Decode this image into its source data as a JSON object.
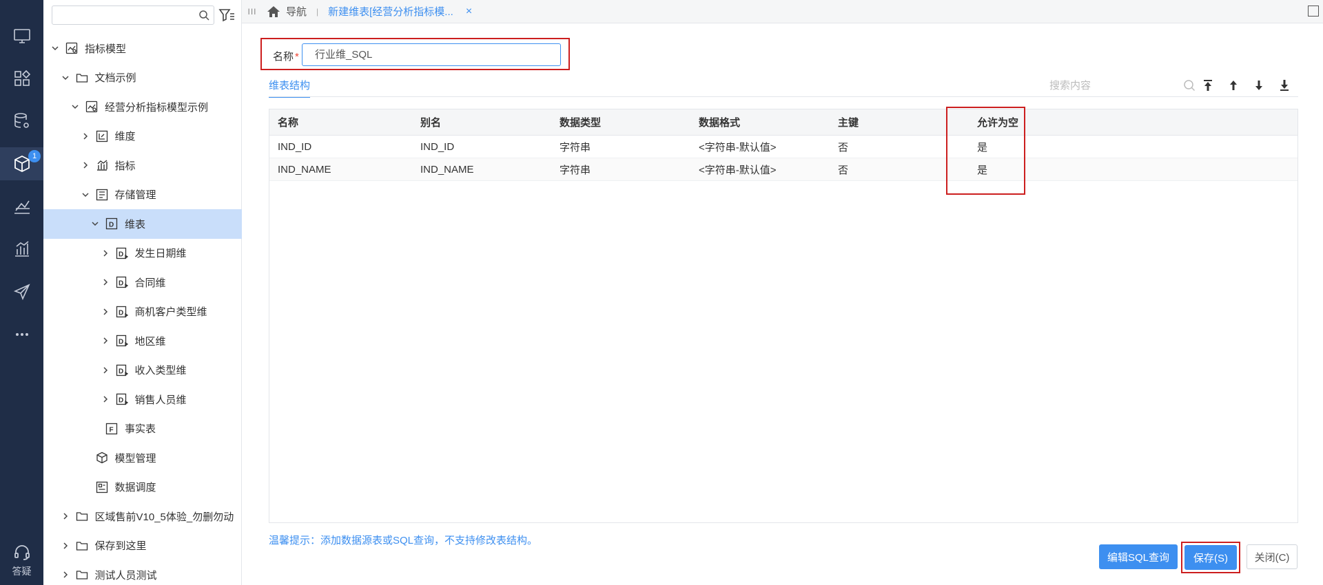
{
  "rail": {
    "badge": "1",
    "help_label": "答疑"
  },
  "tree": {
    "search_placeholder": "",
    "rows": [
      {
        "label": "指标模型",
        "depth": 0,
        "expanded": true,
        "icon": "metric-model-icon"
      },
      {
        "label": "文档示例",
        "depth": 1,
        "expanded": true,
        "icon": "folder-icon"
      },
      {
        "label": "经营分析指标模型示例",
        "depth": 2,
        "expanded": true,
        "icon": "metric-model-icon"
      },
      {
        "label": "维度",
        "depth": 3,
        "expanded": false,
        "icon": "dimension-icon"
      },
      {
        "label": "指标",
        "depth": 3,
        "expanded": false,
        "icon": "bar-chart-icon"
      },
      {
        "label": "存储管理",
        "depth": 3,
        "expanded": true,
        "icon": "storage-icon"
      },
      {
        "label": "维表",
        "depth": 4,
        "expanded": true,
        "icon": "dim-table-icon",
        "selected": true
      },
      {
        "label": "发生日期维",
        "depth": 5,
        "expanded": false,
        "icon": "dim-item-icon"
      },
      {
        "label": "合同维",
        "depth": 5,
        "expanded": false,
        "icon": "dim-item-icon"
      },
      {
        "label": "商机客户类型维",
        "depth": 5,
        "expanded": false,
        "icon": "dim-item-icon"
      },
      {
        "label": "地区维",
        "depth": 5,
        "expanded": false,
        "icon": "dim-item-icon"
      },
      {
        "label": "收入类型维",
        "depth": 5,
        "expanded": false,
        "icon": "dim-item-icon"
      },
      {
        "label": "销售人员维",
        "depth": 5,
        "expanded": false,
        "icon": "dim-item-icon"
      },
      {
        "label": "事实表",
        "depth": 4,
        "leaf": true,
        "icon": "fact-table-icon"
      },
      {
        "label": "模型管理",
        "depth": 3,
        "leaf": true,
        "icon": "model-manage-icon"
      },
      {
        "label": "数据调度",
        "depth": 3,
        "leaf": true,
        "icon": "schedule-icon"
      },
      {
        "label": "区域售前V10_5体验_勿删勿动",
        "depth": 1,
        "expanded": false,
        "icon": "folder-icon"
      },
      {
        "label": "保存到这里",
        "depth": 1,
        "expanded": false,
        "icon": "folder-icon"
      },
      {
        "label": "测试人员测试",
        "depth": 1,
        "expanded": false,
        "icon": "folder-icon"
      }
    ]
  },
  "tabbar": {
    "grip": "III",
    "home_label": "导航",
    "active_tab": "新建维表[经营分析指标模...",
    "close": "×"
  },
  "form": {
    "name_label": "名称",
    "required_mark": "*",
    "name_value": "行业维_SQL"
  },
  "subtab": {
    "label": "维表结构",
    "search_placeholder": "搜索内容"
  },
  "table": {
    "columns": [
      "名称",
      "别名",
      "数据类型",
      "数据格式",
      "主键",
      "允许为空"
    ],
    "rows": [
      [
        "IND_ID",
        "IND_ID",
        "字符串",
        "<字符串-默认值>",
        "否",
        "是"
      ],
      [
        "IND_NAME",
        "IND_NAME",
        "字符串",
        "<字符串-默认值>",
        "否",
        "是"
      ]
    ]
  },
  "tip": "温馨提示：添加数据源表或SQL查询，不支持修改表结构。",
  "buttons": {
    "edit_sql": "编辑SQL查询",
    "save": "保存(S)",
    "close": "关闭(C)"
  },
  "colors": {
    "accent": "#3d8ff0",
    "rail_bg": "#1f2d47",
    "highlight_box": "#cc1e1e",
    "selected_row": "#c9defa"
  }
}
